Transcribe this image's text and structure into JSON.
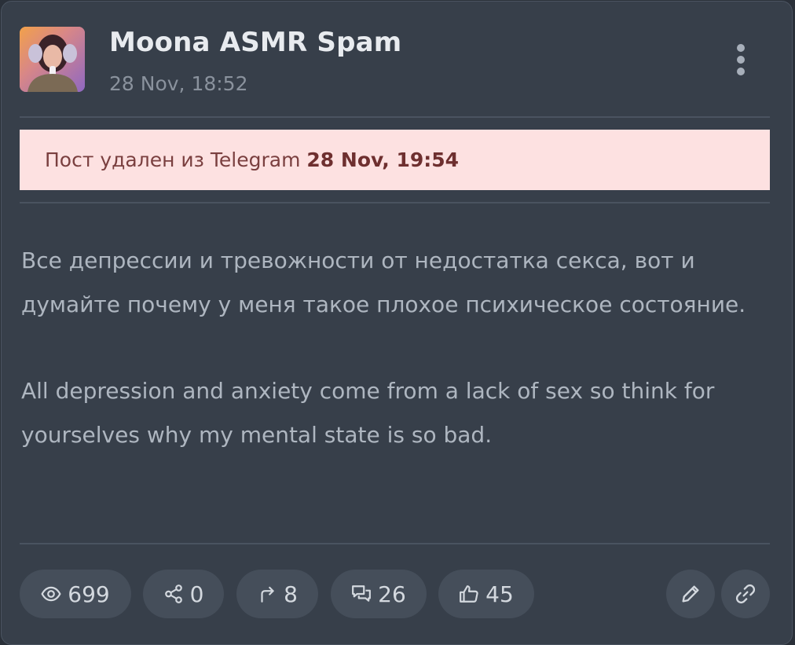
{
  "header": {
    "channel_name": "Moona ASMR Spam",
    "post_time": "28 Nov, 18:52"
  },
  "deleted_notice": {
    "prefix": "Пост удален из Telegram",
    "time": "28 Nov, 19:54"
  },
  "post": {
    "paragraph_ru": "Все депрессии и тревожности от недостатка секса, вот и думайте почему у меня такое плохое психическое состояние.",
    "paragraph_en": "All depression and anxiety come from a lack of sex so think for yourselves why my mental state is so bad."
  },
  "stats": {
    "views": "699",
    "shares": "0",
    "forwards": "8",
    "comments": "26",
    "reactions": "45"
  },
  "icons": {
    "views": "eye-icon",
    "shares": "share-icon",
    "forwards": "forward-arrow-icon",
    "comments": "comments-icon",
    "reactions": "thumbs-up-icon",
    "edit": "pencil-icon",
    "link": "link-icon",
    "menu": "more-vertical-icon"
  },
  "colors": {
    "card_background": "#373f4a",
    "banner_background": "#fde1e1",
    "banner_text": "#7a3f3f"
  }
}
